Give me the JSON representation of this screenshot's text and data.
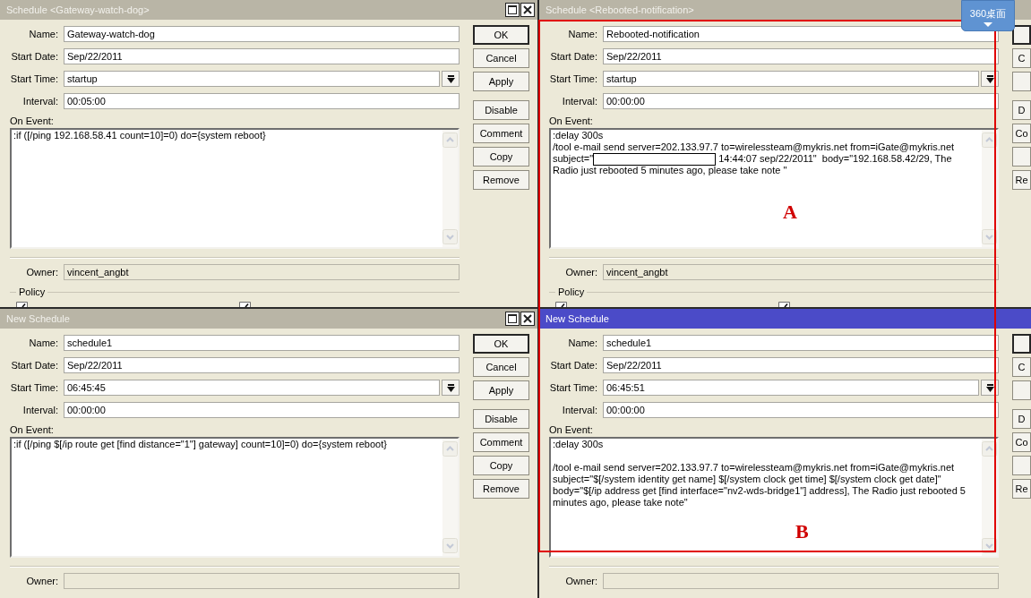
{
  "windows": [
    {
      "title": "Schedule <Gateway-watch-dog>",
      "active": false,
      "title_buttons": [
        {
          "kind": "maximize"
        },
        {
          "kind": "close"
        }
      ],
      "fields": [
        {
          "kind": "text",
          "label": "Name:",
          "value": "Gateway-watch-dog"
        },
        {
          "kind": "text",
          "label": "Start Date:",
          "value": "Sep/22/2011"
        },
        {
          "kind": "dropdown",
          "label": "Start Time:",
          "value": "startup"
        },
        {
          "kind": "text",
          "label": "Interval:",
          "value": "00:05:00"
        }
      ],
      "on_event": {
        "label": "On Event:",
        "lines": [
          {
            "kind": "line",
            "text": ":if ([/ping 192.168.58.41 count=10]=0) do={system reboot}"
          }
        ]
      },
      "owner": {
        "label": "Owner:",
        "value": "vincent_angbt",
        "disabled": true
      },
      "policy": {
        "label": "Policy",
        "checkboxes": [
          {
            "checked": true
          },
          {
            "checked": true
          }
        ]
      },
      "button_groups": [
        [
          {
            "label": "OK",
            "default": true
          },
          {
            "label": "Cancel",
            "default": false
          },
          {
            "label": "Apply",
            "default": false
          }
        ],
        [
          {
            "label": "Disable",
            "default": false
          },
          {
            "label": "Comment",
            "default": false
          },
          {
            "label": "Copy",
            "default": false
          },
          {
            "label": "Remove",
            "default": false
          }
        ]
      ]
    },
    {
      "title": "Schedule <Rebooted-notification>",
      "active": false,
      "fields": [
        {
          "kind": "text",
          "label": "Name:",
          "value": "Rebooted-notification"
        },
        {
          "kind": "text",
          "label": "Start Date:",
          "value": "Sep/22/2011"
        },
        {
          "kind": "dropdown",
          "label": "Start Time:",
          "value": "startup"
        },
        {
          "kind": "text",
          "label": "Interval:",
          "value": "00:00:00"
        }
      ],
      "on_event": {
        "label": "On Event:",
        "lines": [
          {
            "kind": "line",
            "text": ":delay 300s"
          },
          {
            "kind": "line",
            "text": "/tool e-mail send server=202.133.97.7 to=wirelessteam@mykris.net from=iGate@mykris.net"
          },
          {
            "kind": "redacted_line",
            "before": "subject=\"",
            "after": " 14:44:07 sep/22/2011\"  body=\"192.168.58.42/29, The"
          },
          {
            "kind": "line",
            "text": "Radio just rebooted 5 minutes ago, please take note \""
          }
        ]
      },
      "owner": {
        "label": "Owner:",
        "value": "vincent_angbt",
        "disabled": true
      },
      "policy": {
        "label": "Policy",
        "checkboxes": [
          {
            "checked": true
          },
          {
            "checked": true
          }
        ]
      },
      "button_groups": [
        [
          {
            "default": true
          },
          {
            "label": "C",
            "default": false
          },
          {
            "default": false
          }
        ],
        [
          {
            "label": "D",
            "default": false
          },
          {
            "label": "Co",
            "default": false
          },
          {
            "default": false
          },
          {
            "label": "Re",
            "default": false
          }
        ]
      ]
    },
    {
      "title": "New Schedule",
      "active": false,
      "title_buttons": [
        {
          "kind": "maximize"
        },
        {
          "kind": "close"
        }
      ],
      "fields": [
        {
          "kind": "text",
          "label": "Name:",
          "value": "schedule1"
        },
        {
          "kind": "text",
          "label": "Start Date:",
          "value": "Sep/22/2011"
        },
        {
          "kind": "dropdown",
          "label": "Start Time:",
          "value": "06:45:45"
        },
        {
          "kind": "text",
          "label": "Interval:",
          "value": "00:00:00"
        }
      ],
      "on_event": {
        "label": "On Event:",
        "lines": [
          {
            "kind": "line",
            "text": ":if ([/ping $[/ip route get [find distance=\"1\"] gateway] count=10]=0) do={system reboot}"
          }
        ]
      },
      "owner": {
        "label": "Owner:",
        "disabled": true
      },
      "button_groups": [
        [
          {
            "label": "OK",
            "default": true
          },
          {
            "label": "Cancel",
            "default": false
          },
          {
            "label": "Apply",
            "default": false
          }
        ],
        [
          {
            "label": "Disable",
            "default": false
          },
          {
            "label": "Comment",
            "default": false
          },
          {
            "label": "Copy",
            "default": false
          },
          {
            "label": "Remove",
            "default": false
          }
        ]
      ]
    },
    {
      "title": "New Schedule",
      "active": true,
      "fields": [
        {
          "kind": "text",
          "label": "Name:",
          "value": "schedule1"
        },
        {
          "kind": "text",
          "label": "Start Date:",
          "value": "Sep/22/2011"
        },
        {
          "kind": "dropdown",
          "label": "Start Time:",
          "value": "06:45:51"
        },
        {
          "kind": "text",
          "label": "Interval:",
          "value": "00:00:00"
        }
      ],
      "on_event": {
        "label": "On Event:",
        "lines": [
          {
            "kind": "line",
            "text": ":delay 300s"
          },
          {
            "kind": "blank"
          },
          {
            "kind": "line",
            "text": "/tool e-mail send server=202.133.97.7 to=wirelessteam@mykris.net from=iGate@mykris.net"
          },
          {
            "kind": "line",
            "text": "subject=\"$[/system identity get name] $[/system clock get time] $[/system clock get date]\""
          },
          {
            "kind": "line",
            "text": "body=\"$[/ip address get [find interface=\"nv2-wds-bridge1\"] address], The Radio just rebooted 5"
          },
          {
            "kind": "line",
            "text": "minutes ago, please take note\""
          }
        ]
      },
      "owner": {
        "label": "Owner:",
        "disabled": true
      },
      "button_groups": [
        [
          {
            "default": true
          },
          {
            "label": "C",
            "default": false
          },
          {
            "default": false
          }
        ],
        [
          {
            "label": "D",
            "default": false
          },
          {
            "label": "Co",
            "default": false
          },
          {
            "default": false
          },
          {
            "label": "Re",
            "default": false
          }
        ]
      ]
    }
  ],
  "annotations": [
    {
      "label": "A"
    },
    {
      "label": "B"
    }
  ],
  "desktop_widget": {
    "label": "360桌面"
  }
}
